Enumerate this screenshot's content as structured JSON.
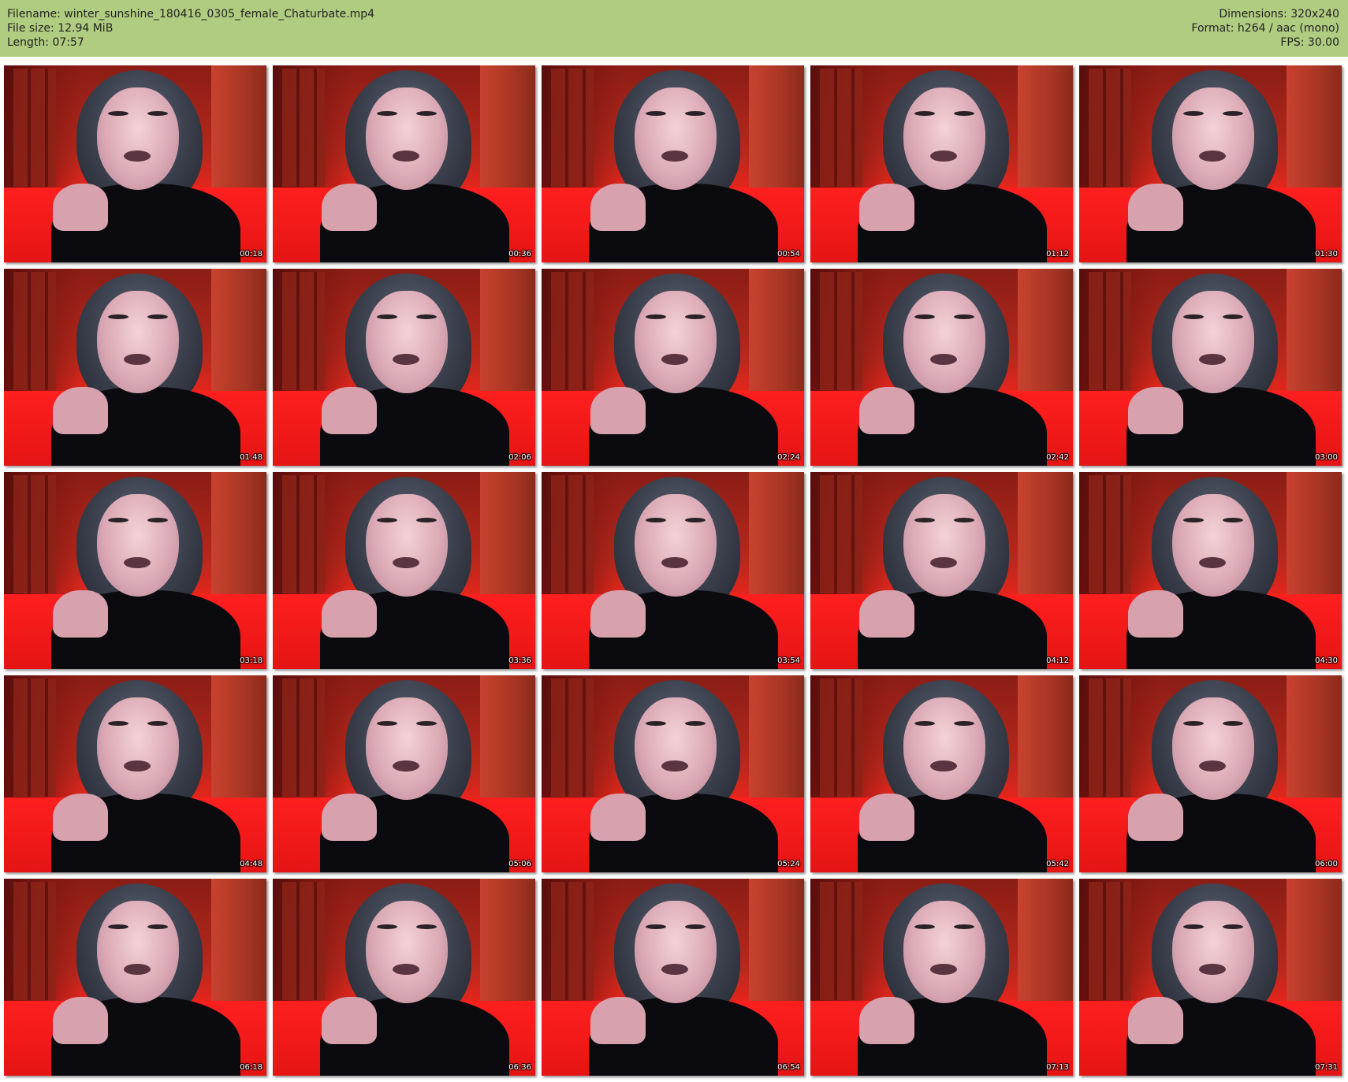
{
  "header": {
    "filename": "Filename: winter_sunshine_180416_0305_female_Chaturbate.mp4",
    "filesize": "File size: 12.94 MiB",
    "length": "Length: 07:57",
    "dimensions": "Dimensions: 320x240",
    "format": "Format: h264 / aac (mono)",
    "fps": "FPS: 30.00"
  },
  "thumbnails": [
    {
      "timestamp": "00:18"
    },
    {
      "timestamp": "00:36"
    },
    {
      "timestamp": "00:54"
    },
    {
      "timestamp": "01:12"
    },
    {
      "timestamp": "01:30"
    },
    {
      "timestamp": "01:48"
    },
    {
      "timestamp": "02:06"
    },
    {
      "timestamp": "02:24"
    },
    {
      "timestamp": "02:42"
    },
    {
      "timestamp": "03:00"
    },
    {
      "timestamp": "03:18"
    },
    {
      "timestamp": "03:36"
    },
    {
      "timestamp": "03:54"
    },
    {
      "timestamp": "04:12"
    },
    {
      "timestamp": "04:30"
    },
    {
      "timestamp": "04:48"
    },
    {
      "timestamp": "05:06"
    },
    {
      "timestamp": "05:24"
    },
    {
      "timestamp": "05:42"
    },
    {
      "timestamp": "06:00"
    },
    {
      "timestamp": "06:18"
    },
    {
      "timestamp": "06:36"
    },
    {
      "timestamp": "06:54"
    },
    {
      "timestamp": "07:13"
    },
    {
      "timestamp": "07:31"
    }
  ],
  "colors": {
    "header_bg": "#b0cc80",
    "page_bg": "#ffffff",
    "timestamp_text": "#ffffff"
  }
}
